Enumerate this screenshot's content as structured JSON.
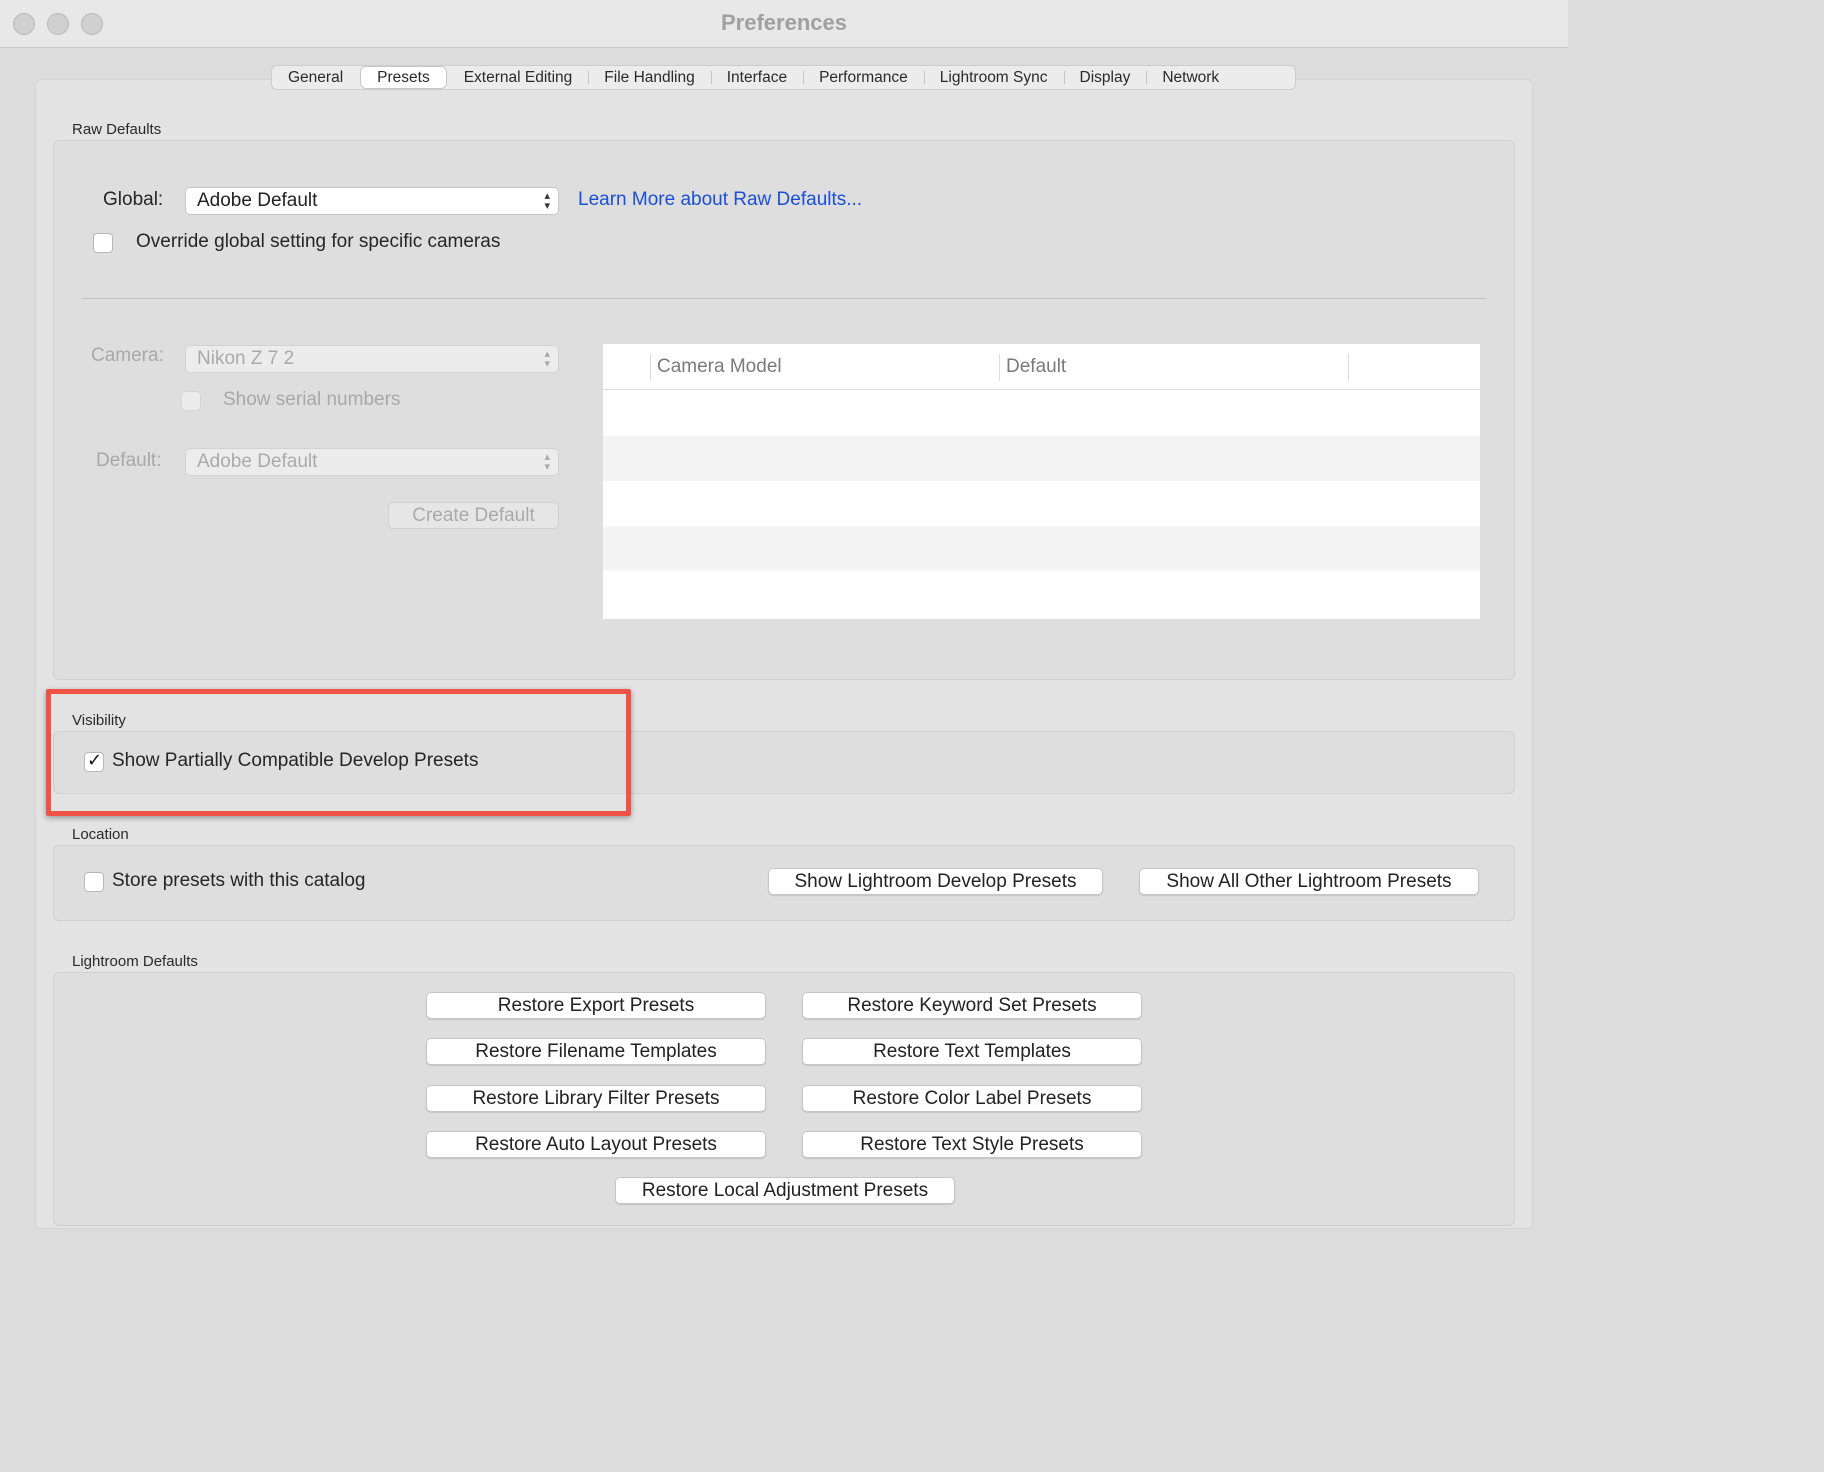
{
  "window": {
    "title": "Preferences"
  },
  "tabs": [
    "General",
    "Presets",
    "External Editing",
    "File Handling",
    "Interface",
    "Performance",
    "Lightroom Sync",
    "Display",
    "Network"
  ],
  "active_tab": "Presets",
  "raw_defaults": {
    "section_label": "Raw Defaults",
    "global_label": "Global:",
    "global_value": "Adobe Default",
    "learn_more_link": "Learn More about Raw Defaults...",
    "override_label": "Override global setting for specific cameras",
    "override_checked": false,
    "camera_label": "Camera:",
    "camera_value": "Nikon Z 7 2",
    "show_serial_label": "Show serial numbers",
    "default_label": "Default:",
    "default_value": "Adobe Default",
    "create_default_button": "Create Default",
    "table_columns": [
      "Camera Model",
      "Default"
    ]
  },
  "visibility": {
    "section_label": "Visibility",
    "show_partial_label": "Show Partially Compatible Develop Presets",
    "show_partial_checked": true
  },
  "location": {
    "section_label": "Location",
    "store_label": "Store presets with this catalog",
    "store_checked": false,
    "show_develop_button": "Show Lightroom Develop Presets",
    "show_other_button": "Show All Other Lightroom Presets"
  },
  "lightroom_defaults": {
    "section_label": "Lightroom Defaults",
    "restore_export": "Restore Export Presets",
    "restore_keyword": "Restore Keyword Set Presets",
    "restore_filename": "Restore Filename Templates",
    "restore_text_templates": "Restore Text Templates",
    "restore_library_filter": "Restore Library Filter Presets",
    "restore_color_label": "Restore Color Label Presets",
    "restore_auto_layout": "Restore Auto Layout Presets",
    "restore_text_style": "Restore Text Style Presets",
    "restore_local_adjustment": "Restore Local Adjustment Presets"
  },
  "colors": {
    "highlight": "#ee5346",
    "link": "#1a4fd6",
    "window_bg": "#dcdcdc"
  },
  "icons": {
    "close": "close-icon",
    "minimize": "minimize-icon",
    "zoom": "zoom-icon",
    "select_arrows": "chevron-updown-icon",
    "check": "checkmark-icon"
  }
}
